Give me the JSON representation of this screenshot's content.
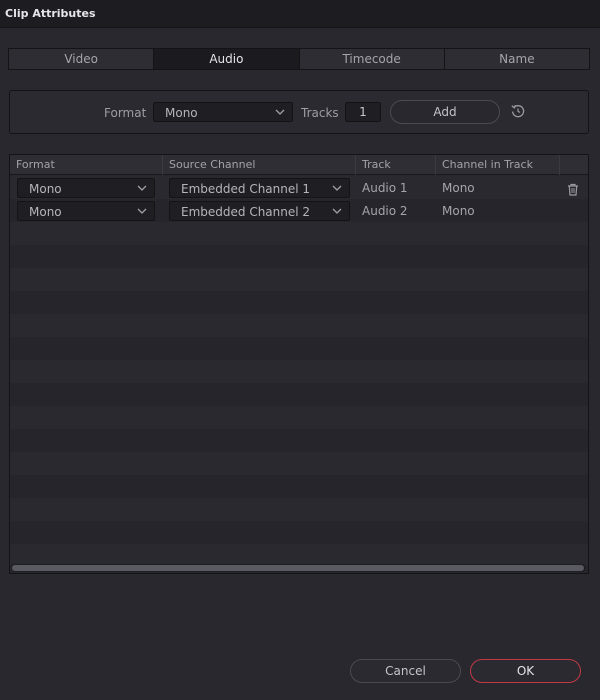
{
  "window": {
    "title": "Clip Attributes"
  },
  "tabs": [
    {
      "label": "Video"
    },
    {
      "label": "Audio",
      "active": true
    },
    {
      "label": "Timecode"
    },
    {
      "label": "Name"
    }
  ],
  "format_panel": {
    "format_label": "Format",
    "format_value": "Mono",
    "tracks_label": "Tracks",
    "tracks_value": "1",
    "add_label": "Add",
    "reset_icon": "reset-icon"
  },
  "table": {
    "columns": [
      "Format",
      "Source Channel",
      "Track",
      "Channel in Track"
    ],
    "rows": [
      {
        "format": "Mono",
        "source": "Embedded Channel 1",
        "track": "Audio 1",
        "channel": "Mono"
      },
      {
        "format": "Mono",
        "source": "Embedded Channel 2",
        "track": "Audio 2",
        "channel": "Mono"
      }
    ],
    "delete_icon": "trash-icon"
  },
  "footer": {
    "cancel_label": "Cancel",
    "ok_label": "OK"
  },
  "colors": {
    "accent_ok_border": "#c23a46",
    "background": "#28282e"
  }
}
